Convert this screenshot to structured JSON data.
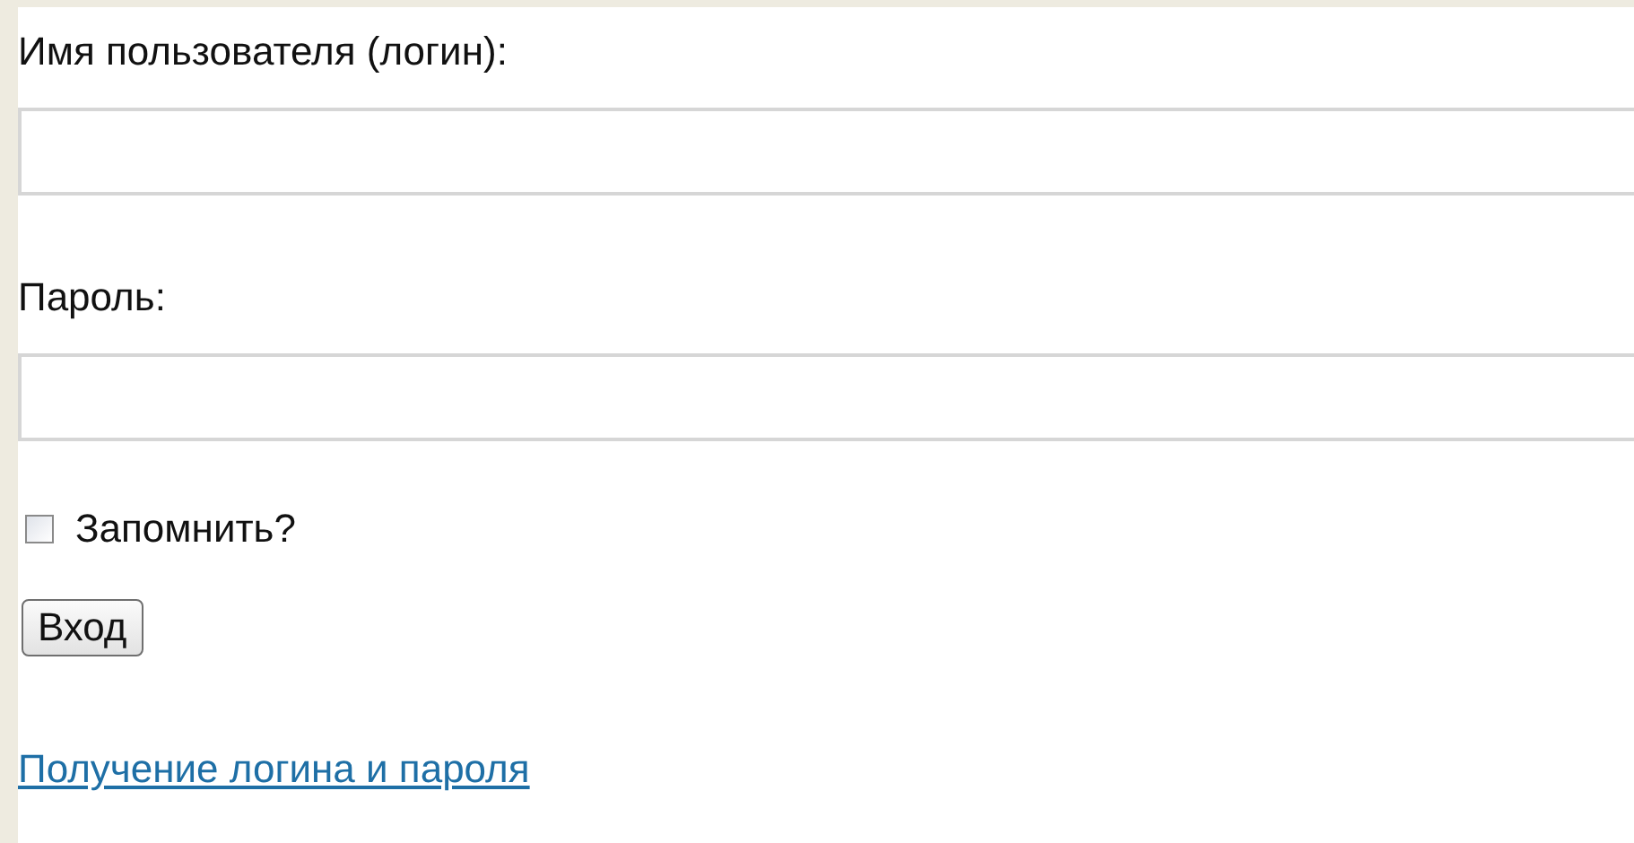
{
  "form": {
    "username": {
      "label": "Имя пользователя (логин):"
    },
    "password": {
      "label": "Пароль:"
    },
    "remember": {
      "label": "Запомнить?",
      "checked": false
    },
    "submit": {
      "label": "Вход"
    },
    "link": {
      "label": "Получение логина и пароля"
    }
  }
}
